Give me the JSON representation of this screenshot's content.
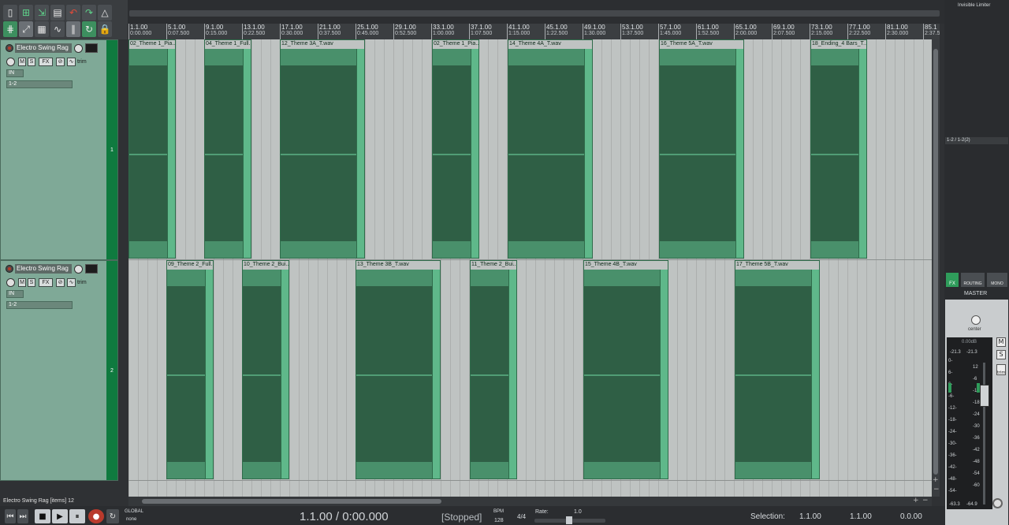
{
  "track_names": [
    "Electro Swing Rag",
    "Electro Swing Rag"
  ],
  "track_numbers": [
    "1",
    "2"
  ],
  "track_io": [
    "1-2",
    "1-2"
  ],
  "tcp_buttons": {
    "m": "M",
    "s": "S",
    "fx": "FX",
    "trim": "trim",
    "in": "IN"
  },
  "ruler": [
    {
      "b": "1.1.00",
      "t": "0:00.000"
    },
    {
      "b": "5.1.00",
      "t": "0:07.500"
    },
    {
      "b": "9.1.00",
      "t": "0:15.000"
    },
    {
      "b": "13.1.00",
      "t": "0:22.500"
    },
    {
      "b": "17.1.00",
      "t": "0:30.000"
    },
    {
      "b": "21.1.00",
      "t": "0:37.500"
    },
    {
      "b": "25.1.00",
      "t": "0:45.000"
    },
    {
      "b": "29.1.00",
      "t": "0:52.500"
    },
    {
      "b": "33.1.00",
      "t": "1:00.000"
    },
    {
      "b": "37.1.00",
      "t": "1:07.500"
    },
    {
      "b": "41.1.00",
      "t": "1:15.000"
    },
    {
      "b": "45.1.00",
      "t": "1:22.500"
    },
    {
      "b": "49.1.00",
      "t": "1:30.000"
    },
    {
      "b": "53.1.00",
      "t": "1:37.500"
    },
    {
      "b": "57.1.00",
      "t": "1:45.000"
    },
    {
      "b": "61.1.00",
      "t": "1:52.500"
    },
    {
      "b": "65.1.00",
      "t": "2:00.000"
    },
    {
      "b": "69.1.00",
      "t": "2:07.500"
    },
    {
      "b": "73.1.00",
      "t": "2:15.000"
    },
    {
      "b": "77.1.00",
      "t": "2:22.500"
    },
    {
      "b": "81.1.00",
      "t": "2:30.000"
    },
    {
      "b": "85.1",
      "t": "2:37.5"
    }
  ],
  "items_track1": [
    "02_Theme 1_Pia...",
    "04_Theme 1_Full...",
    "12_Theme 3A_T.wav",
    "02_Theme 1_Pia...",
    "14_Theme 4A_T.wav",
    "16_Theme 5A_T.wav",
    "18_Ending_4 Bars_T..."
  ],
  "items_track2": [
    "09_Theme 2_Full...",
    "10_Theme 2_Bui...",
    "13_Theme 3B_T.wav",
    "11_Theme 2_Bui...",
    "15_Theme 4B_T.wav",
    "17_Theme 5B_T.wav"
  ],
  "status": {
    "text": "Electro Swing Rag [items] 12",
    "global": "GLOBAL",
    "none": "none"
  },
  "transport": {
    "position": "1.1.00 / 0:00.000",
    "state": "[Stopped]",
    "bpm_label": "BPM",
    "bpm": "128",
    "timesig": "4/4",
    "rate_label": "Rate:",
    "rate": "1.0",
    "selection_label": "Selection:",
    "sel_start": "1.1.00",
    "sel_end": "1.1.00",
    "sel_len": "0.0.00"
  },
  "master": {
    "fx_title": "Invisible Limiter",
    "routing_io": "1-2 / 1-2(2)",
    "fx": "FX",
    "routing": "ROUTING",
    "mono": "MONO",
    "label": "MASTER",
    "pan": "center",
    "volume": "0.00dB",
    "peak_l": "-21.3",
    "peak_r": "-21.3",
    "m": "M",
    "s": "S",
    "trim": "trim",
    "bottom_l": "-63.3",
    "bottom_r": "-64.9",
    "scale": [
      "0-",
      "12",
      "6-",
      "-6",
      "6-",
      "-12",
      "-6-",
      "-18",
      "-12-",
      "-24",
      "-18-",
      "-30",
      "-24-",
      "-36",
      "-30-",
      "-42",
      "-36-",
      "-48",
      "-42-",
      "-54",
      "-48-",
      "-60",
      "-54-"
    ]
  },
  "colors": {
    "item": "#5fb88a",
    "item_dark": "#2f5f45",
    "track_num": "#0f7a3f",
    "tcp": "#7fa997"
  }
}
